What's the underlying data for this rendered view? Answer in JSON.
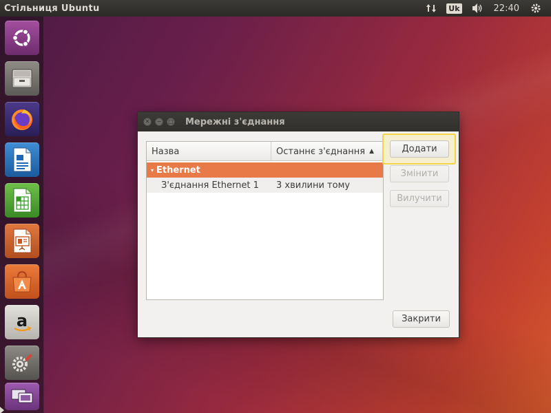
{
  "top_panel": {
    "title": "Стільниця Ubuntu",
    "keyboard_layout": "Uk",
    "time": "22:40"
  },
  "launcher": {
    "items": [
      {
        "name": "dash",
        "icon": "ubuntu-logo-icon"
      },
      {
        "name": "files",
        "icon": "file-cabinet-icon"
      },
      {
        "name": "firefox",
        "icon": "firefox-icon"
      },
      {
        "name": "libreoffice-writer",
        "icon": "writer-icon"
      },
      {
        "name": "libreoffice-calc",
        "icon": "calc-icon"
      },
      {
        "name": "libreoffice-impress",
        "icon": "impress-icon"
      },
      {
        "name": "ubuntu-software",
        "icon": "software-store-icon"
      },
      {
        "name": "amazon",
        "icon": "amazon-icon"
      },
      {
        "name": "system-settings",
        "icon": "settings-icon"
      },
      {
        "name": "network-connections",
        "icon": "network-connections-icon"
      }
    ]
  },
  "dialog": {
    "title": "Мережні з'єднання",
    "columns": {
      "name": "Назва",
      "last_used": "Останнє з'єднання"
    },
    "groups": [
      {
        "label": "Ethernet",
        "connections": [
          {
            "name": "З'єднання Ethernet 1",
            "last_used": "3 хвилини тому"
          }
        ]
      }
    ],
    "buttons": {
      "add": "Додати",
      "edit": "Змінити",
      "remove": "Вилучити",
      "close": "Закрити"
    }
  },
  "colors": {
    "selection": "#e87a48",
    "highlight": "#f3d34a",
    "panel": "#3c3b37"
  }
}
